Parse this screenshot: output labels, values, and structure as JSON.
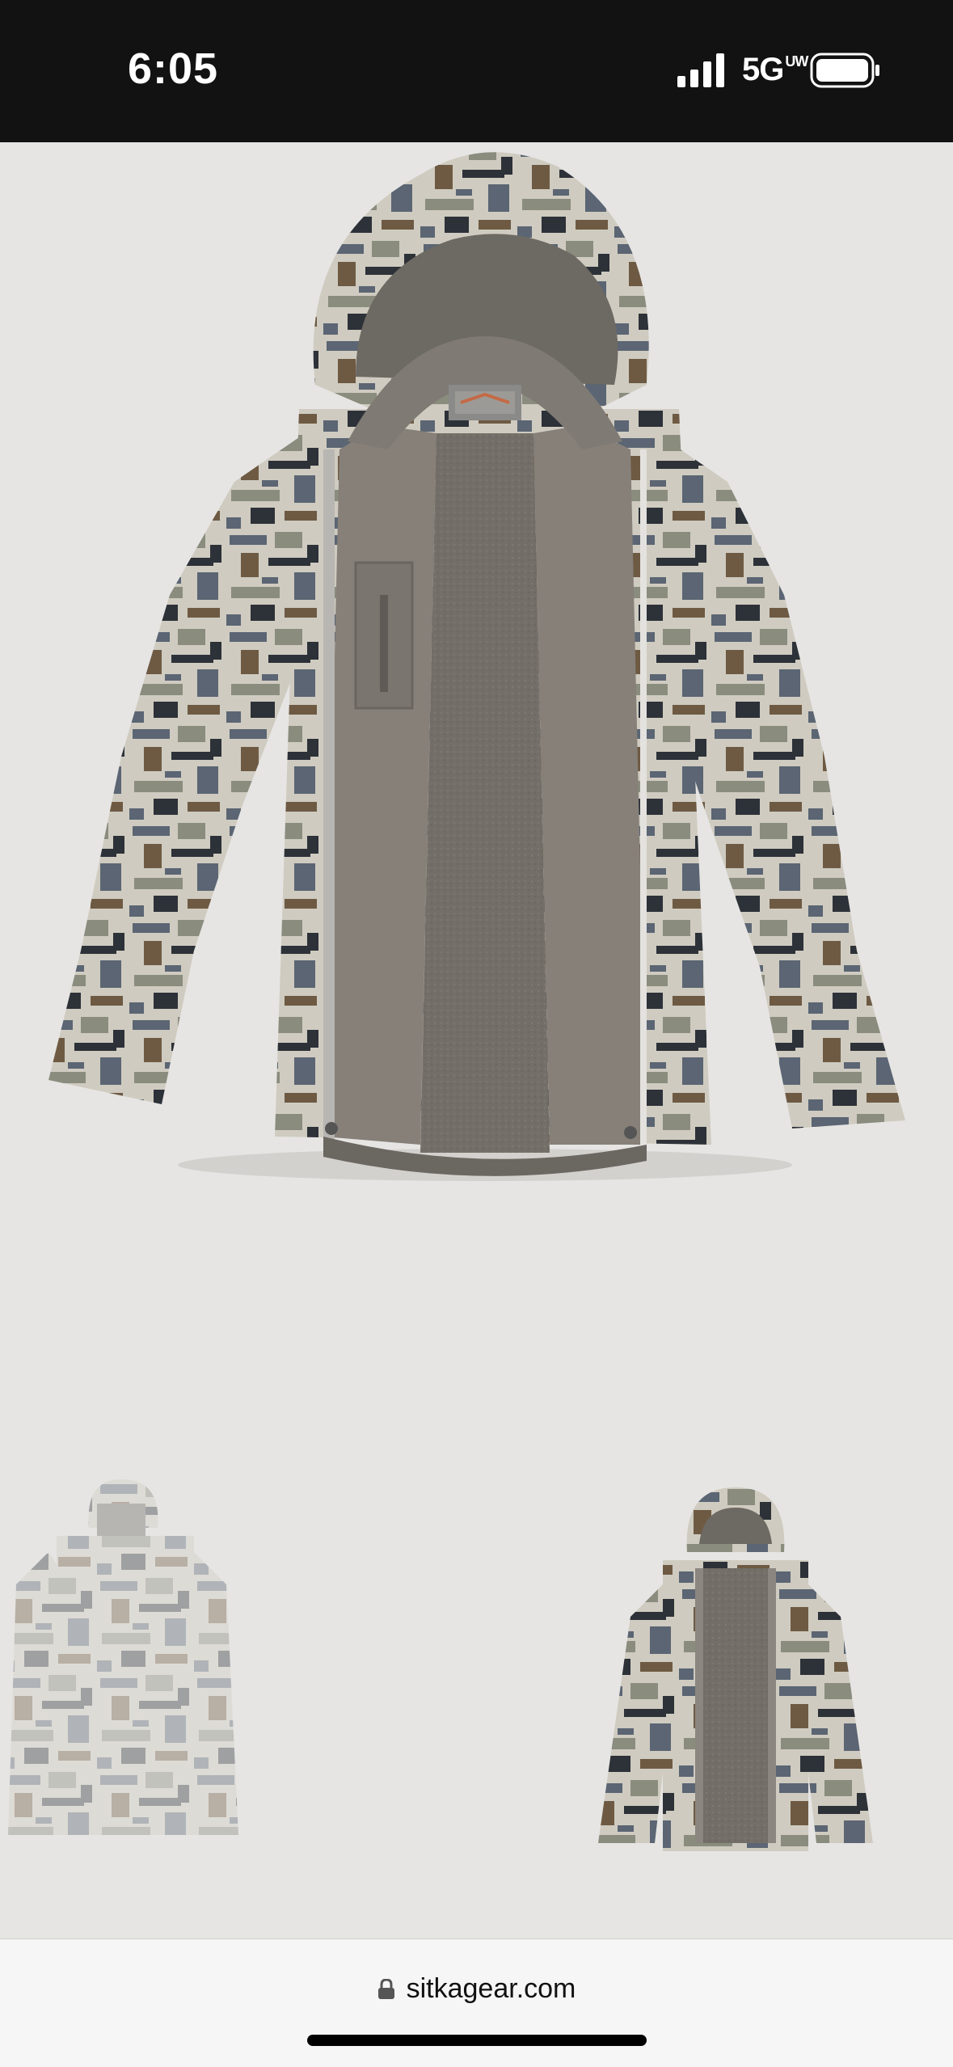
{
  "status_bar": {
    "time": "6:05",
    "network": "5G",
    "network_suffix": "UW",
    "icons": [
      "signal-icon",
      "battery-icon"
    ]
  },
  "product": {
    "main_image": "camo-hooded-jacket-open-front-view",
    "thumbnails": [
      "camo-hooded-jacket-faded-thumbnail",
      "camo-hooded-jacket-open-thumbnail"
    ],
    "camo_colors": [
      "#cfcbc0",
      "#8a8c7e",
      "#5b6573",
      "#6e5a43",
      "#2d3138"
    ],
    "lining_color": "#757069"
  },
  "browser": {
    "url": "sitkagear.com"
  }
}
